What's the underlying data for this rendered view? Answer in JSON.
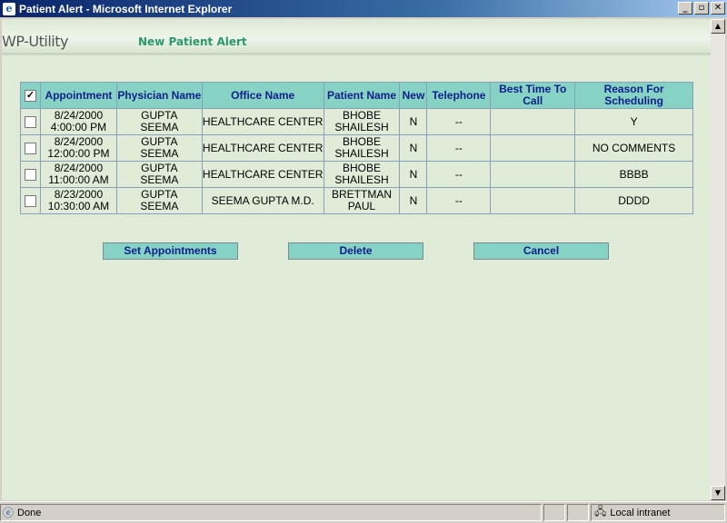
{
  "window": {
    "title": "Patient Alert - Microsoft Internet Explorer",
    "icon": "e",
    "minimize": "_",
    "maximize": "▫",
    "close": "✕"
  },
  "header": {
    "brand": "WP-Utility",
    "page_title": "New Patient Alert"
  },
  "table": {
    "columns": [
      "Appointment",
      "Physician Name",
      "Office Name",
      "Patient Name",
      "New",
      "Telephone",
      "Best Time To Call",
      "Reason For Scheduling"
    ],
    "select_all_checked": true,
    "rows": [
      {
        "date": "8/24/2000",
        "time": "4:00:00 PM",
        "physician_last": "GUPTA",
        "physician_first": "SEEMA",
        "office": "HEALTHCARE CENTER",
        "patient_last": "BHOBE",
        "patient_first": "SHAILESH",
        "new": "N",
        "telephone": "--",
        "best_time": "",
        "reason": "Y"
      },
      {
        "date": "8/24/2000",
        "time": "12:00:00 PM",
        "physician_last": "GUPTA",
        "physician_first": "SEEMA",
        "office": "HEALTHCARE CENTER",
        "patient_last": "BHOBE",
        "patient_first": "SHAILESH",
        "new": "N",
        "telephone": "--",
        "best_time": "",
        "reason": "NO COMMENTS"
      },
      {
        "date": "8/24/2000",
        "time": "11:00:00 AM",
        "physician_last": "GUPTA",
        "physician_first": "SEEMA",
        "office": "HEALTHCARE CENTER",
        "patient_last": "BHOBE",
        "patient_first": "SHAILESH",
        "new": "N",
        "telephone": "--",
        "best_time": "",
        "reason": "BBBB"
      },
      {
        "date": "8/23/2000",
        "time": "10:30:00 AM",
        "physician_last": "GUPTA",
        "physician_first": "SEEMA",
        "office": "SEEMA GUPTA M.D.",
        "patient_last": "BRETTMAN",
        "patient_first": "PAUL",
        "new": "N",
        "telephone": "--",
        "best_time": "",
        "reason": "DDDD"
      }
    ]
  },
  "actions": {
    "set_appointments": "Set Appointments",
    "delete": "Delete",
    "cancel": "Cancel"
  },
  "statusbar": {
    "status": "Done",
    "zone": "Local intranet"
  },
  "colors": {
    "header_cell": "#86d2c4",
    "header_text": "#10208a",
    "page_bg": "#e0ecd8",
    "title_green": "#2a9a6a"
  }
}
